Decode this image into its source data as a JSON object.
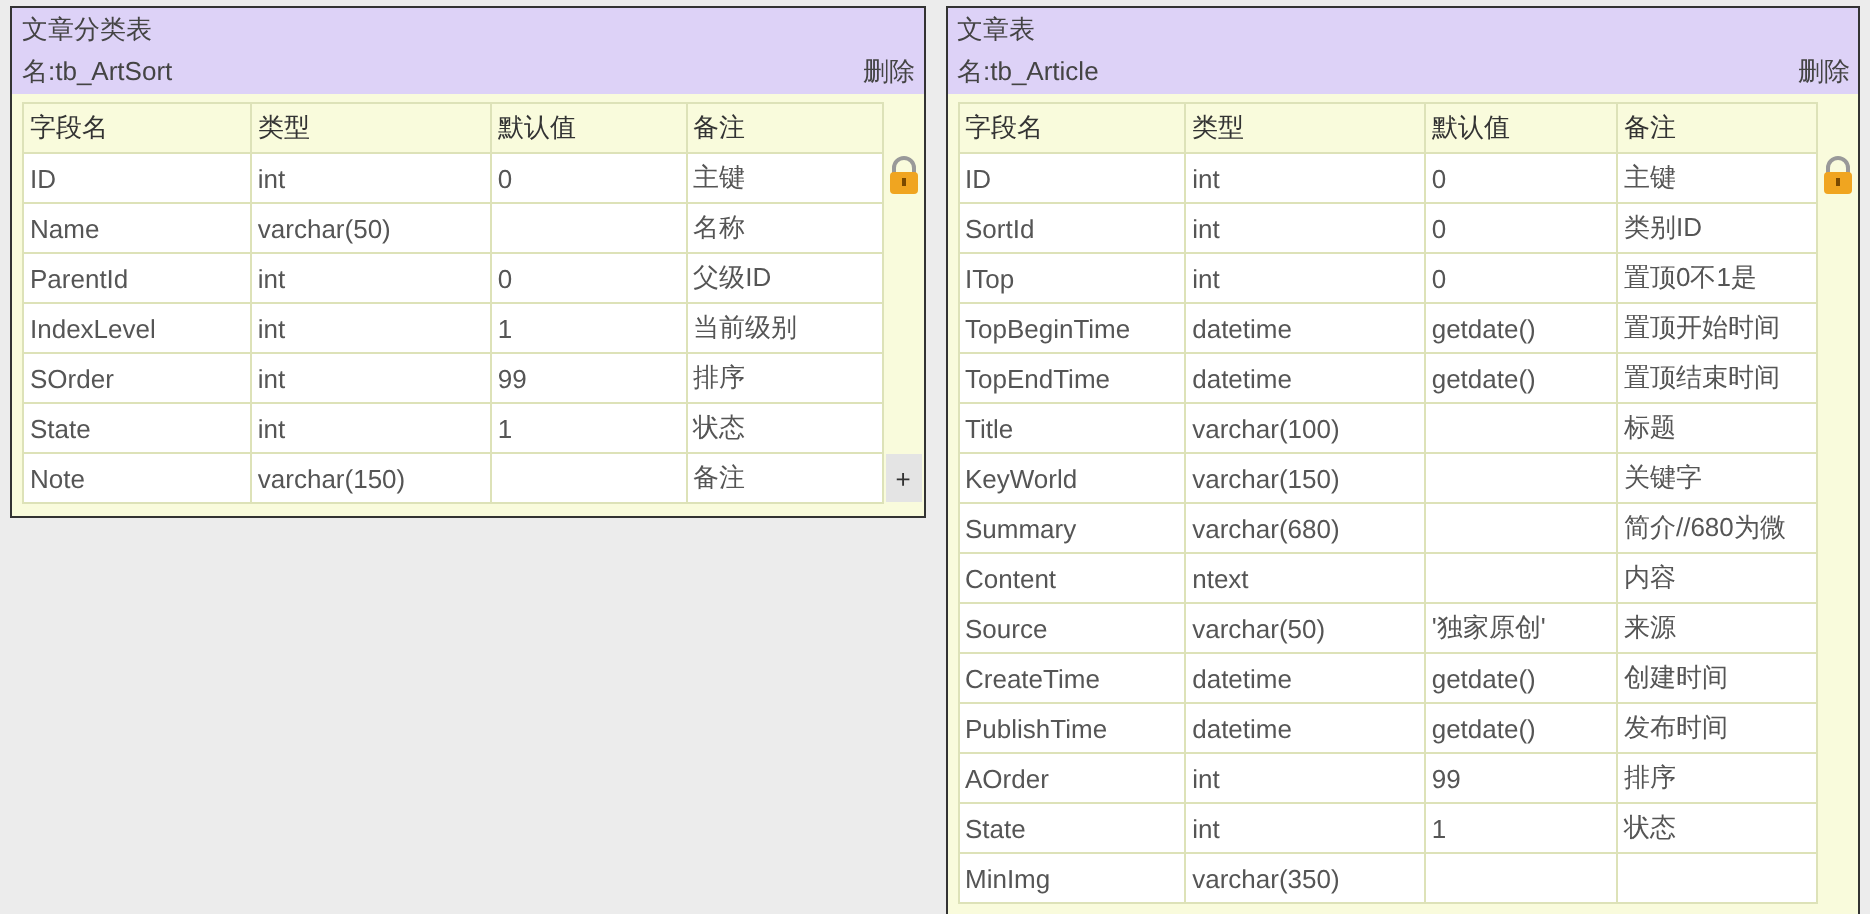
{
  "tables": [
    {
      "title": "文章分类表",
      "name": "名:tb_ArtSort",
      "delete": "删除",
      "add": "+",
      "columns": [
        "字段名",
        "类型",
        "默认值",
        "备注"
      ],
      "rows": [
        {
          "field": "ID",
          "type": "int",
          "default": "0",
          "remark": "主键"
        },
        {
          "field": "Name",
          "type": "varchar(50)",
          "remark": "名称"
        },
        {
          "field": "ParentId",
          "type": "int",
          "default": "0",
          "remark": "父级ID"
        },
        {
          "field": "IndexLevel",
          "type": "int",
          "default": "1",
          "remark": "当前级别"
        },
        {
          "field": "SOrder",
          "type": "int",
          "default": "99",
          "remark": "排序"
        },
        {
          "field": "State",
          "type": "int",
          "default": "1",
          "remark": "状态"
        },
        {
          "field": "Note",
          "type": "varchar(150)",
          "remark": "备注"
        }
      ]
    },
    {
      "title": "文章表",
      "name": "名:tb_Article",
      "delete": "删除",
      "columns": [
        "字段名",
        "类型",
        "默认值",
        "备注"
      ],
      "rows": [
        {
          "field": "ID",
          "type": "int",
          "default": "0",
          "remark": "主键"
        },
        {
          "field": "SortId",
          "type": "int",
          "default": "0",
          "remark": "类别ID"
        },
        {
          "field": "ITop",
          "type": "int",
          "default": "0",
          "remark": "置顶0不1是"
        },
        {
          "field": "TopBeginTime",
          "type": "datetime",
          "default": "getdate()",
          "remark": "置顶开始时间"
        },
        {
          "field": "TopEndTime",
          "type": "datetime",
          "default": "getdate()",
          "remark": "置顶结束时间"
        },
        {
          "field": "Title",
          "type": "varchar(100)",
          "remark": "标题"
        },
        {
          "field": "KeyWorld",
          "type": "varchar(150)",
          "remark": "关键字"
        },
        {
          "field": "Summary",
          "type": "varchar(680)",
          "remark": "简介//680为微"
        },
        {
          "field": "Content",
          "type": "ntext",
          "remark": "内容"
        },
        {
          "field": "Source",
          "type": "varchar(50)",
          "default": "'独家原创'",
          "remark": "来源"
        },
        {
          "field": "CreateTime",
          "type": "datetime",
          "default": "getdate()",
          "remark": "创建时间"
        },
        {
          "field": "PublishTime",
          "type": "datetime",
          "default": "getdate()",
          "remark": "发布时间"
        },
        {
          "field": "AOrder",
          "type": "int",
          "default": "99",
          "remark": "排序"
        },
        {
          "field": "State",
          "type": "int",
          "default": "1",
          "remark": "状态"
        },
        {
          "field": "MinImg",
          "type": "varchar(350)"
        }
      ]
    }
  ]
}
